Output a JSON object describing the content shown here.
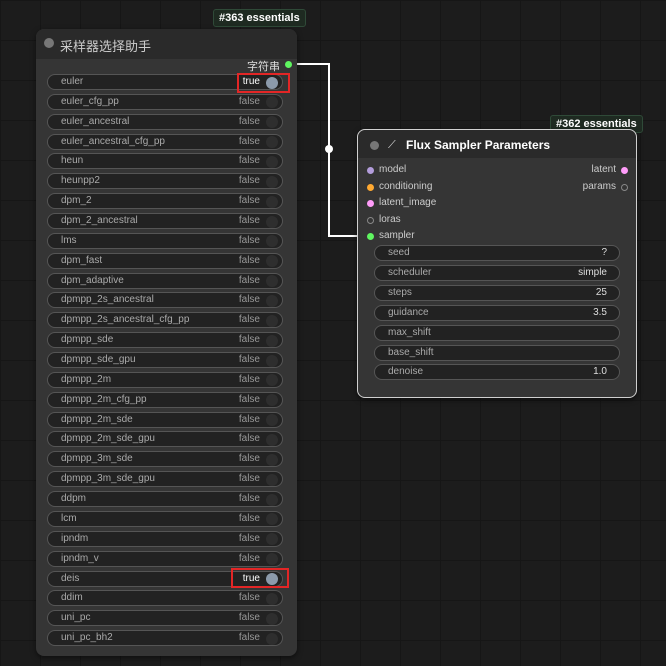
{
  "left_node": {
    "badge": "#363 essentials",
    "title": "采样器选择助手",
    "output_label": "字符串",
    "toggles": [
      {
        "label": "euler",
        "value": "true"
      },
      {
        "label": "euler_cfg_pp",
        "value": "false"
      },
      {
        "label": "euler_ancestral",
        "value": "false"
      },
      {
        "label": "euler_ancestral_cfg_pp",
        "value": "false"
      },
      {
        "label": "heun",
        "value": "false"
      },
      {
        "label": "heunpp2",
        "value": "false"
      },
      {
        "label": "dpm_2",
        "value": "false"
      },
      {
        "label": "dpm_2_ancestral",
        "value": "false"
      },
      {
        "label": "lms",
        "value": "false"
      },
      {
        "label": "dpm_fast",
        "value": "false"
      },
      {
        "label": "dpm_adaptive",
        "value": "false"
      },
      {
        "label": "dpmpp_2s_ancestral",
        "value": "false"
      },
      {
        "label": "dpmpp_2s_ancestral_cfg_pp",
        "value": "false"
      },
      {
        "label": "dpmpp_sde",
        "value": "false"
      },
      {
        "label": "dpmpp_sde_gpu",
        "value": "false"
      },
      {
        "label": "dpmpp_2m",
        "value": "false"
      },
      {
        "label": "dpmpp_2m_cfg_pp",
        "value": "false"
      },
      {
        "label": "dpmpp_2m_sde",
        "value": "false"
      },
      {
        "label": "dpmpp_2m_sde_gpu",
        "value": "false"
      },
      {
        "label": "dpmpp_3m_sde",
        "value": "false"
      },
      {
        "label": "dpmpp_3m_sde_gpu",
        "value": "false"
      },
      {
        "label": "ddpm",
        "value": "false"
      },
      {
        "label": "lcm",
        "value": "false"
      },
      {
        "label": "ipndm",
        "value": "false"
      },
      {
        "label": "ipndm_v",
        "value": "false"
      },
      {
        "label": "deis",
        "value": "true"
      },
      {
        "label": "ddim",
        "value": "false"
      },
      {
        "label": "uni_pc",
        "value": "false"
      },
      {
        "label": "uni_pc_bh2",
        "value": "false"
      }
    ]
  },
  "right_node": {
    "badge": "#362 essentials",
    "title": "Flux Sampler Parameters",
    "inputs": [
      {
        "label": "model",
        "color": "#b39ddb"
      },
      {
        "label": "conditioning",
        "color": "#ffa931"
      },
      {
        "label": "latent_image",
        "color": "#ff9cf9"
      },
      {
        "label": "loras",
        "color": "#555555"
      },
      {
        "label": "sampler",
        "color": "#5ff560"
      }
    ],
    "outputs": [
      {
        "label": "latent",
        "color": "#ff9cf9"
      },
      {
        "label": "params",
        "color": "#555555"
      }
    ],
    "widgets": [
      {
        "label": "seed",
        "value": "?"
      },
      {
        "label": "scheduler",
        "value": "simple"
      },
      {
        "label": "steps",
        "value": "25"
      },
      {
        "label": "guidance",
        "value": "3.5"
      },
      {
        "label": "max_shift",
        "value": ""
      },
      {
        "label": "base_shift",
        "value": ""
      },
      {
        "label": "denoise",
        "value": "1.0"
      }
    ]
  },
  "colors": {
    "highlight": "#e32626",
    "link": "#ffffff",
    "string_slot": "#5ff560"
  }
}
